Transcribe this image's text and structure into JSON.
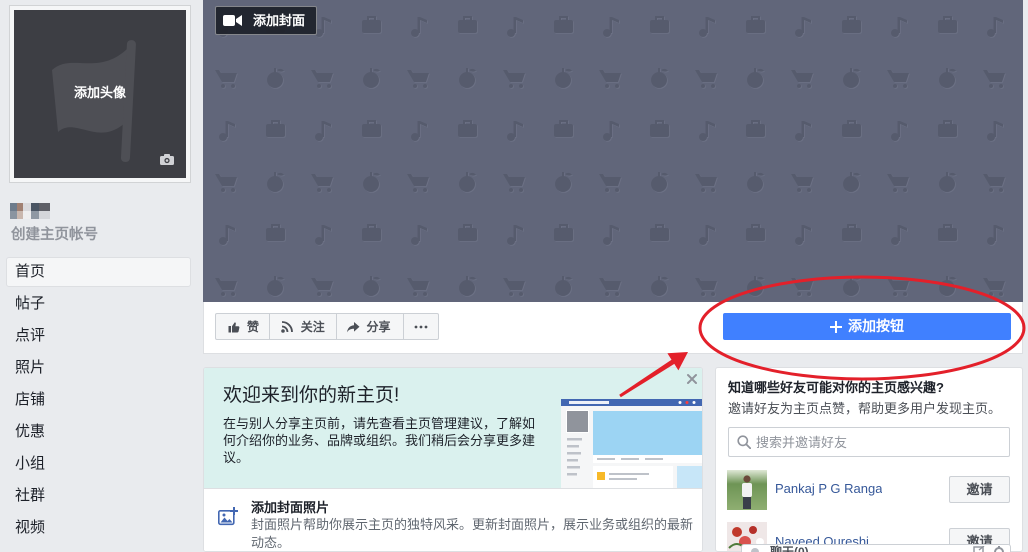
{
  "sidebar": {
    "avatar_label": "添加头像",
    "create_username_label": "创建主页帐号",
    "nav": [
      {
        "label": "首页",
        "active": true
      },
      {
        "label": "帖子"
      },
      {
        "label": "点评"
      },
      {
        "label": "照片"
      },
      {
        "label": "店铺"
      },
      {
        "label": "优惠"
      },
      {
        "label": "小组"
      },
      {
        "label": "社群"
      },
      {
        "label": "视频"
      }
    ]
  },
  "cover": {
    "add_cover_label": "添加封面"
  },
  "actions": {
    "like_label": "赞",
    "follow_label": "关注",
    "share_label": "分享"
  },
  "cta": {
    "label": "添加按钮"
  },
  "welcome": {
    "title": "欢迎来到你的新主页!",
    "body": "在与别人分享主页前，请先查看主页管理建议，了解如何介绍你的业务、品牌或组织。我们稍后会分享更多建议。"
  },
  "tip": {
    "title": "添加封面照片",
    "body": "封面照片帮助你展示主页的独特风采。更新封面照片，展示业务或组织的最新动态。"
  },
  "invite": {
    "title": "知道哪些好友可能对你的主页感兴趣?",
    "subtitle": "邀请好友为主页点赞，帮助更多用户发现主页。",
    "search_placeholder": "搜索并邀请好友",
    "friends": [
      {
        "name": "Pankaj P G Ranga",
        "button": "邀请"
      },
      {
        "name": "Naveed Qureshi",
        "button": "邀请"
      }
    ]
  },
  "chat": {
    "label": "聊天(0)"
  },
  "icons": {
    "profile": "flag-icon",
    "profile_camera": "camera-icon",
    "add_cover": "video-camera-icon",
    "like": "thumbs-up-icon",
    "follow": "rss-icon",
    "share": "share-arrow-icon",
    "more": "more-dots-icon",
    "cta": "plus-icon",
    "close": "close-icon",
    "tip": "add-photo-icon",
    "search": "search-icon",
    "chat_compose": "compose-icon",
    "chat_settings": "gear-icon"
  },
  "colors": {
    "page_bg": "#e9ebee",
    "cover_bg": "#61667a",
    "primary_button": "#4080ff",
    "link": "#365899",
    "welcome_bg": "#daf1ee",
    "annotation": "#e3202a"
  }
}
